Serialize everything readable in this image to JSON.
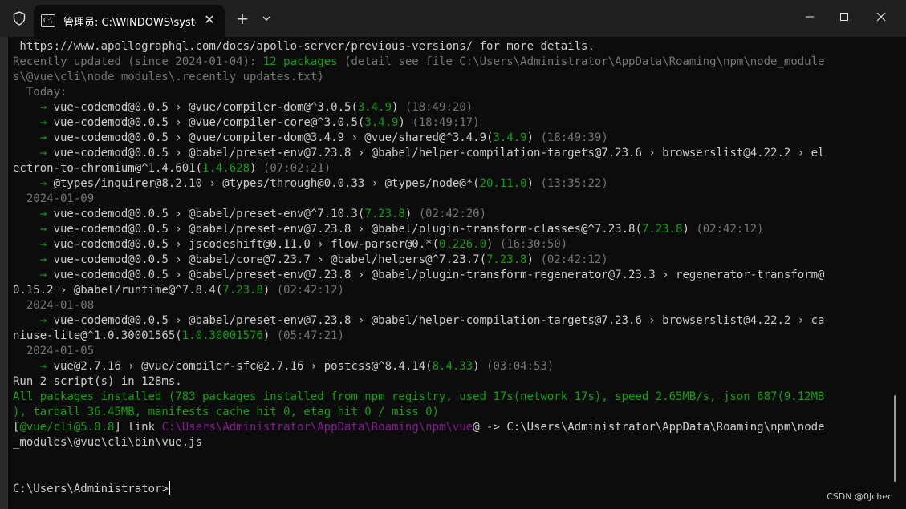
{
  "window": {
    "tab_title": "管理员: C:\\WINDOWS\\system",
    "tab_icon_text": "C:\\",
    "tab_close": "✕",
    "new_tab": "+",
    "controls": {
      "minimize": "minimize",
      "maximize": "maximize",
      "close": "close"
    }
  },
  "terminal": {
    "lines": [
      [
        {
          "t": " https://www.apollographql.com/docs/apollo-server/previous-versions/ for more details.",
          "c": ""
        }
      ],
      [
        {
          "t": "Recently updated (since 2024-01-04): ",
          "c": "d"
        },
        {
          "t": "12 packages",
          "c": "g"
        },
        {
          "t": " (detail see file C:\\Users\\Administrator\\AppData\\Roaming\\npm\\node_module",
          "c": "d"
        }
      ],
      [
        {
          "t": "s\\@vue\\cli\\node_modules\\.recently_updates.txt)",
          "c": "d"
        }
      ],
      [
        {
          "t": "  Today:",
          "c": "d"
        }
      ],
      [
        {
          "t": "    → ",
          "c": "g"
        },
        {
          "t": "vue-codemod@0.0.5 › @vue/compiler-dom@^3.0.5(",
          "c": ""
        },
        {
          "t": "3.4.9",
          "c": "g"
        },
        {
          "t": ") ",
          "c": ""
        },
        {
          "t": "(18:49:20)",
          "c": "d"
        }
      ],
      [
        {
          "t": "    → ",
          "c": "g"
        },
        {
          "t": "vue-codemod@0.0.5 › @vue/compiler-core@^3.0.5(",
          "c": ""
        },
        {
          "t": "3.4.9",
          "c": "g"
        },
        {
          "t": ") ",
          "c": ""
        },
        {
          "t": "(18:49:17)",
          "c": "d"
        }
      ],
      [
        {
          "t": "    → ",
          "c": "g"
        },
        {
          "t": "vue-codemod@0.0.5 › @vue/compiler-dom@3.4.9 › @vue/shared@^3.4.9(",
          "c": ""
        },
        {
          "t": "3.4.9",
          "c": "g"
        },
        {
          "t": ") ",
          "c": ""
        },
        {
          "t": "(18:49:39)",
          "c": "d"
        }
      ],
      [
        {
          "t": "    → ",
          "c": "g"
        },
        {
          "t": "vue-codemod@0.0.5 › @babel/preset-env@7.23.8 › @babel/helper-compilation-targets@7.23.6 › browserslist@4.22.2 › el",
          "c": ""
        }
      ],
      [
        {
          "t": "ectron-to-chromium@^1.4.601(",
          "c": ""
        },
        {
          "t": "1.4.628",
          "c": "g"
        },
        {
          "t": ") ",
          "c": ""
        },
        {
          "t": "(07:02:21)",
          "c": "d"
        }
      ],
      [
        {
          "t": "    → ",
          "c": "g"
        },
        {
          "t": "@types/inquirer@8.2.10 › @types/through@0.0.33 › @types/node@*(",
          "c": ""
        },
        {
          "t": "20.11.0",
          "c": "g"
        },
        {
          "t": ") ",
          "c": ""
        },
        {
          "t": "(13:35:22)",
          "c": "d"
        }
      ],
      [
        {
          "t": "  2024-01-09",
          "c": "d"
        }
      ],
      [
        {
          "t": "    → ",
          "c": "g"
        },
        {
          "t": "vue-codemod@0.0.5 › @babel/preset-env@^7.10.3(",
          "c": ""
        },
        {
          "t": "7.23.8",
          "c": "g"
        },
        {
          "t": ") ",
          "c": ""
        },
        {
          "t": "(02:42:20)",
          "c": "d"
        }
      ],
      [
        {
          "t": "    → ",
          "c": "g"
        },
        {
          "t": "vue-codemod@0.0.5 › @babel/preset-env@7.23.8 › @babel/plugin-transform-classes@^7.23.8(",
          "c": ""
        },
        {
          "t": "7.23.8",
          "c": "g"
        },
        {
          "t": ") ",
          "c": ""
        },
        {
          "t": "(02:42:12)",
          "c": "d"
        }
      ],
      [
        {
          "t": "    → ",
          "c": "g"
        },
        {
          "t": "vue-codemod@0.0.5 › jscodeshift@0.11.0 › flow-parser@0.*(",
          "c": ""
        },
        {
          "t": "0.226.0",
          "c": "g"
        },
        {
          "t": ") ",
          "c": ""
        },
        {
          "t": "(16:30:50)",
          "c": "d"
        }
      ],
      [
        {
          "t": "    → ",
          "c": "g"
        },
        {
          "t": "vue-codemod@0.0.5 › @babel/core@7.23.7 › @babel/helpers@^7.23.7(",
          "c": ""
        },
        {
          "t": "7.23.8",
          "c": "g"
        },
        {
          "t": ") ",
          "c": ""
        },
        {
          "t": "(02:42:12)",
          "c": "d"
        }
      ],
      [
        {
          "t": "    → ",
          "c": "g"
        },
        {
          "t": "vue-codemod@0.0.5 › @babel/preset-env@7.23.8 › @babel/plugin-transform-regenerator@7.23.3 › regenerator-transform@",
          "c": ""
        }
      ],
      [
        {
          "t": "0.15.2 › @babel/runtime@^7.8.4(",
          "c": ""
        },
        {
          "t": "7.23.8",
          "c": "g"
        },
        {
          "t": ") ",
          "c": ""
        },
        {
          "t": "(02:42:12)",
          "c": "d"
        }
      ],
      [
        {
          "t": "  2024-01-08",
          "c": "d"
        }
      ],
      [
        {
          "t": "    → ",
          "c": "g"
        },
        {
          "t": "vue-codemod@0.0.5 › @babel/preset-env@7.23.8 › @babel/helper-compilation-targets@7.23.6 › browserslist@4.22.2 › ca",
          "c": ""
        }
      ],
      [
        {
          "t": "niuse-lite@^1.0.30001565(",
          "c": ""
        },
        {
          "t": "1.0.30001576",
          "c": "g"
        },
        {
          "t": ") ",
          "c": ""
        },
        {
          "t": "(05:47:21)",
          "c": "d"
        }
      ],
      [
        {
          "t": "  2024-01-05",
          "c": "d"
        }
      ],
      [
        {
          "t": "    → ",
          "c": "g"
        },
        {
          "t": "vue@2.7.16 › @vue/compiler-sfc@2.7.16 › postcss@^8.4.14(",
          "c": ""
        },
        {
          "t": "8.4.33",
          "c": "g"
        },
        {
          "t": ") ",
          "c": ""
        },
        {
          "t": "(03:04:53)",
          "c": "d"
        }
      ],
      [
        {
          "t": "Run 2 script(s) in 128ms.",
          "c": ""
        }
      ],
      [
        {
          "t": "All packages installed (783 packages installed from npm registry, used 17s(network 17s), speed 2.65MB/s, json 687(9.12MB",
          "c": "g"
        }
      ],
      [
        {
          "t": "), tarball 36.45MB, manifests cache hit 0, etag hit 0 / miss 0)",
          "c": "g"
        }
      ],
      [
        {
          "t": "[",
          "c": ""
        },
        {
          "t": "@vue/cli@5.0.8",
          "c": "g"
        },
        {
          "t": "] link ",
          "c": ""
        },
        {
          "t": "C:\\Users\\Administrator\\AppData\\Roaming\\npm\\vue",
          "c": "p"
        },
        {
          "t": "@ -> C:\\Users\\Administrator\\AppData\\Roaming\\npm\\node",
          "c": ""
        }
      ],
      [
        {
          "t": "_modules\\@vue\\cli\\bin\\vue.js",
          "c": ""
        }
      ],
      [
        {
          "t": "",
          "c": ""
        }
      ],
      [
        {
          "t": "",
          "c": ""
        }
      ],
      [
        {
          "t": "C:\\Users\\Administrator>",
          "c": ""
        }
      ]
    ]
  },
  "watermark": "CSDN @0Jchen",
  "colors": {
    "background": "#0c0c0c",
    "titlebar": "#202020",
    "text": "#cccccc",
    "green": "#13a10e",
    "gray": "#767676",
    "magenta": "#881798"
  },
  "icons": [
    "shield-icon",
    "terminal-icon",
    "close-icon",
    "plus-icon",
    "chevron-down-icon",
    "minimize-icon",
    "maximize-icon",
    "window-close-icon"
  ]
}
